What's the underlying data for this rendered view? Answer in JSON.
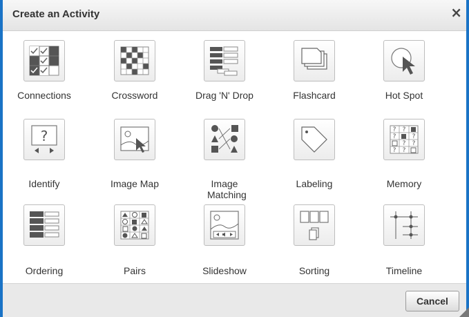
{
  "dialog": {
    "title": "Create an Activity",
    "close_glyph": "×",
    "cancel_label": "Cancel"
  },
  "activities": [
    {
      "label": "Connections",
      "icon": "connections-icon"
    },
    {
      "label": "Crossword",
      "icon": "crossword-icon"
    },
    {
      "label": "Drag 'N' Drop",
      "icon": "drag-n-drop-icon"
    },
    {
      "label": "Flashcard",
      "icon": "flashcard-icon"
    },
    {
      "label": "Hot Spot",
      "icon": "hot-spot-icon"
    },
    {
      "label": "Identify",
      "icon": "identify-icon"
    },
    {
      "label": "Image Map",
      "icon": "image-map-icon"
    },
    {
      "label": "Image Matching",
      "icon": "image-matching-icon"
    },
    {
      "label": "Labeling",
      "icon": "labeling-icon"
    },
    {
      "label": "Memory",
      "icon": "memory-icon"
    },
    {
      "label": "Ordering",
      "icon": "ordering-icon"
    },
    {
      "label": "Pairs",
      "icon": "pairs-icon"
    },
    {
      "label": "Slideshow",
      "icon": "slideshow-icon"
    },
    {
      "label": "Sorting",
      "icon": "sorting-icon"
    },
    {
      "label": "Timeline",
      "icon": "timeline-icon"
    }
  ]
}
